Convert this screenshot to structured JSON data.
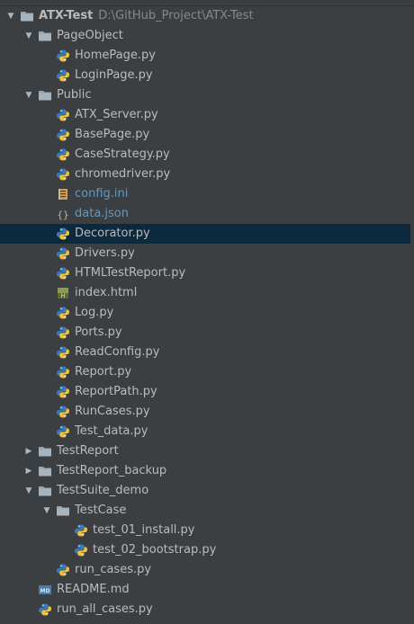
{
  "tree": [
    {
      "level": 0,
      "type": "folder",
      "expanded": true,
      "label": "ATX-Test",
      "path": "D:\\GitHub_Project\\ATX-Test",
      "bold": true,
      "name": "tree-root-atx-test"
    },
    {
      "level": 1,
      "type": "folder",
      "expanded": true,
      "label": "PageObject",
      "name": "tree-folder-pageobject"
    },
    {
      "level": 2,
      "type": "py",
      "label": "HomePage.py",
      "name": "tree-file-homepage"
    },
    {
      "level": 2,
      "type": "py",
      "label": "LoginPage.py",
      "name": "tree-file-loginpage"
    },
    {
      "level": 1,
      "type": "folder",
      "expanded": true,
      "label": "Public",
      "name": "tree-folder-public"
    },
    {
      "level": 2,
      "type": "py",
      "label": "ATX_Server.py",
      "name": "tree-file-atx-server"
    },
    {
      "level": 2,
      "type": "py",
      "label": "BasePage.py",
      "name": "tree-file-basepage"
    },
    {
      "level": 2,
      "type": "py",
      "label": "CaseStrategy.py",
      "name": "tree-file-casestrategy"
    },
    {
      "level": 2,
      "type": "py",
      "label": "chromedriver.py",
      "name": "tree-file-chromedriver"
    },
    {
      "level": 2,
      "type": "ini",
      "label": "config.ini",
      "blue": true,
      "name": "tree-file-config-ini"
    },
    {
      "level": 2,
      "type": "json",
      "label": "data.json",
      "blue": true,
      "name": "tree-file-data-json"
    },
    {
      "level": 2,
      "type": "py",
      "label": "Decorator.py",
      "selected": true,
      "name": "tree-file-decorator"
    },
    {
      "level": 2,
      "type": "py",
      "label": "Drivers.py",
      "name": "tree-file-drivers"
    },
    {
      "level": 2,
      "type": "py",
      "label": "HTMLTestReport.py",
      "name": "tree-file-htmltestreport"
    },
    {
      "level": 2,
      "type": "html",
      "label": "index.html",
      "name": "tree-file-index-html"
    },
    {
      "level": 2,
      "type": "py",
      "label": "Log.py",
      "name": "tree-file-log"
    },
    {
      "level": 2,
      "type": "py",
      "label": "Ports.py",
      "name": "tree-file-ports"
    },
    {
      "level": 2,
      "type": "py",
      "label": "ReadConfig.py",
      "name": "tree-file-readconfig"
    },
    {
      "level": 2,
      "type": "py",
      "label": "Report.py",
      "name": "tree-file-report"
    },
    {
      "level": 2,
      "type": "py",
      "label": "ReportPath.py",
      "name": "tree-file-reportpath"
    },
    {
      "level": 2,
      "type": "py",
      "label": "RunCases.py",
      "name": "tree-file-runcases"
    },
    {
      "level": 2,
      "type": "py",
      "label": "Test_data.py",
      "name": "tree-file-test-data"
    },
    {
      "level": 1,
      "type": "folder",
      "expanded": false,
      "label": "TestReport",
      "name": "tree-folder-testreport"
    },
    {
      "level": 1,
      "type": "folder",
      "expanded": false,
      "label": "TestReport_backup",
      "name": "tree-folder-testreport-backup"
    },
    {
      "level": 1,
      "type": "folder",
      "expanded": true,
      "label": "TestSuite_demo",
      "name": "tree-folder-testsuite-demo"
    },
    {
      "level": 2,
      "type": "folder",
      "expanded": true,
      "label": "TestCase",
      "name": "tree-folder-testcase"
    },
    {
      "level": 3,
      "type": "py",
      "label": "test_01_install.py",
      "name": "tree-file-test-01-install"
    },
    {
      "level": 3,
      "type": "py",
      "label": "test_02_bootstrap.py",
      "name": "tree-file-test-02-bootstrap"
    },
    {
      "level": 2,
      "type": "py",
      "label": "run_cases.py",
      "name": "tree-file-run-cases"
    },
    {
      "level": 1,
      "type": "md",
      "label": "README.md",
      "name": "tree-file-readme"
    },
    {
      "level": 1,
      "type": "py",
      "label": "run_all_cases.py",
      "name": "tree-file-run-all-cases"
    }
  ],
  "colors": {
    "background": "#3c3f41",
    "selection": "#0d293e",
    "text": "#bbbbbb",
    "path_text": "#888888",
    "nonpy_text": "#6897bb",
    "folder": "#9aa7b0",
    "python_blue": "#3d7ab8",
    "python_yellow": "#f0c33c"
  }
}
